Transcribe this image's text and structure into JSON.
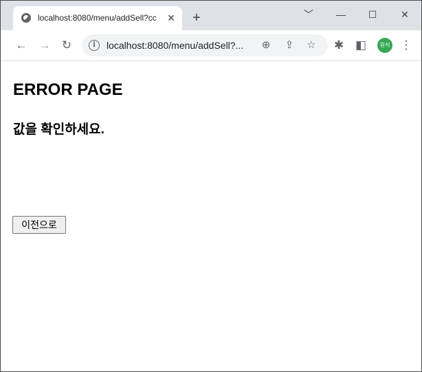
{
  "browser": {
    "tab_title": "localhost:8080/menu/addSell?cc",
    "url": "localhost:8080/menu/addSell?...",
    "new_tab_glyph": "+",
    "close_tab_glyph": "✕",
    "profile_initials": "원석",
    "icons": {
      "back": "back-arrow-icon",
      "forward": "forward-arrow-icon",
      "reload": "reload-icon",
      "info": "info-icon",
      "zoom": "zoom-icon",
      "share": "share-icon",
      "bookmark": "star-icon",
      "extensions": "puzzle-icon",
      "sidepanel": "side-panel-icon",
      "menu": "kebab-menu-icon"
    },
    "window_controls": {
      "dropdown": "﹀",
      "minimize": "—",
      "maximize": "☐",
      "close": "✕"
    },
    "profile_color": "#34a853"
  },
  "page": {
    "heading": "ERROR PAGE",
    "message": "값을 확인하세요.",
    "back_button_label": "이전으로"
  }
}
